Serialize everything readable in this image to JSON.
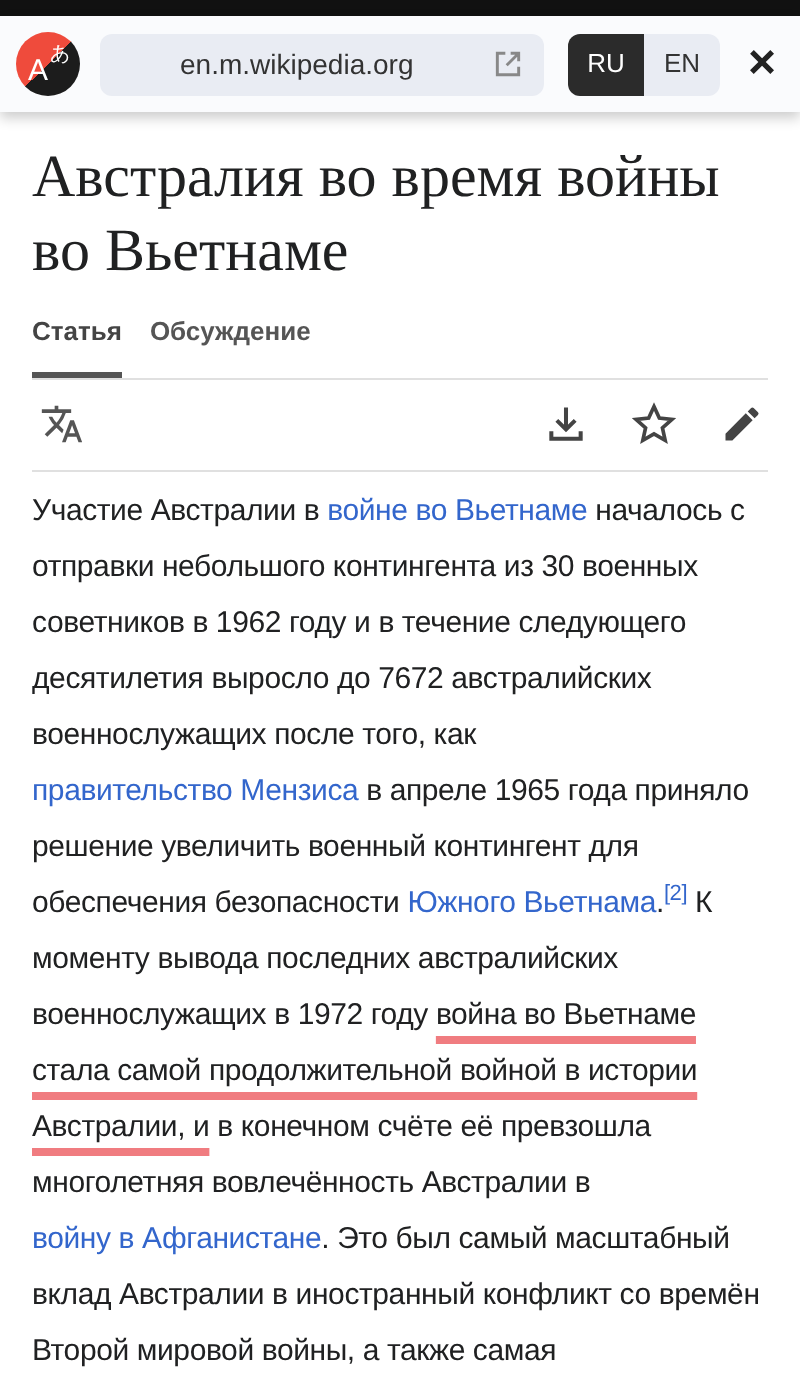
{
  "translate_bar": {
    "logo": {
      "latin": "A",
      "kana": "あ"
    },
    "url": "en.m.wikipedia.org",
    "languages": [
      {
        "label": "RU",
        "selected": true
      },
      {
        "label": "EN",
        "selected": false
      }
    ],
    "close": "×"
  },
  "article": {
    "title": "Австралия во время войны во Вьетнаме",
    "tabs": [
      {
        "label": "Статья",
        "selected": true
      },
      {
        "label": "Обсуждение",
        "selected": false
      }
    ],
    "paragraph": [
      {
        "kind": "text",
        "text": "Участие Австралии в "
      },
      {
        "kind": "link",
        "text": "войне во Вьетнаме"
      },
      {
        "kind": "text",
        "text": " началось с отправки небольшого контингента из 30 военных советников в 1962 году и в течение следующего десятилетия выросло до 7672 австралийских военнослужащих после того, как "
      },
      {
        "kind": "link",
        "text": "правительство Мензиса"
      },
      {
        "kind": "text",
        "text": " в апреле 1965 года приняло решение увеличить военный контингент для обеспечения безопасности "
      },
      {
        "kind": "link",
        "text": "Южного Вьетнама"
      },
      {
        "kind": "text",
        "text": "."
      },
      {
        "kind": "ref",
        "text": "[2]"
      },
      {
        "kind": "text",
        "text": " К моменту вывода последних австралийских военнослужащих в 1972 году "
      },
      {
        "kind": "pen_marked",
        "text": "война во Вьетнаме стала самой продолжительной войной в истории Австралии, и"
      },
      {
        "kind": "text",
        "text": " в конечном счёте её превзошла многолетняя вовлечённость Австралии в "
      },
      {
        "kind": "link",
        "text": "войну в Афганистане"
      },
      {
        "kind": "text",
        "text": ". Это был самый масштабный вклад Австралии в иностранный конфликт со времён Второй мировой войны, а также самая"
      }
    ]
  }
}
